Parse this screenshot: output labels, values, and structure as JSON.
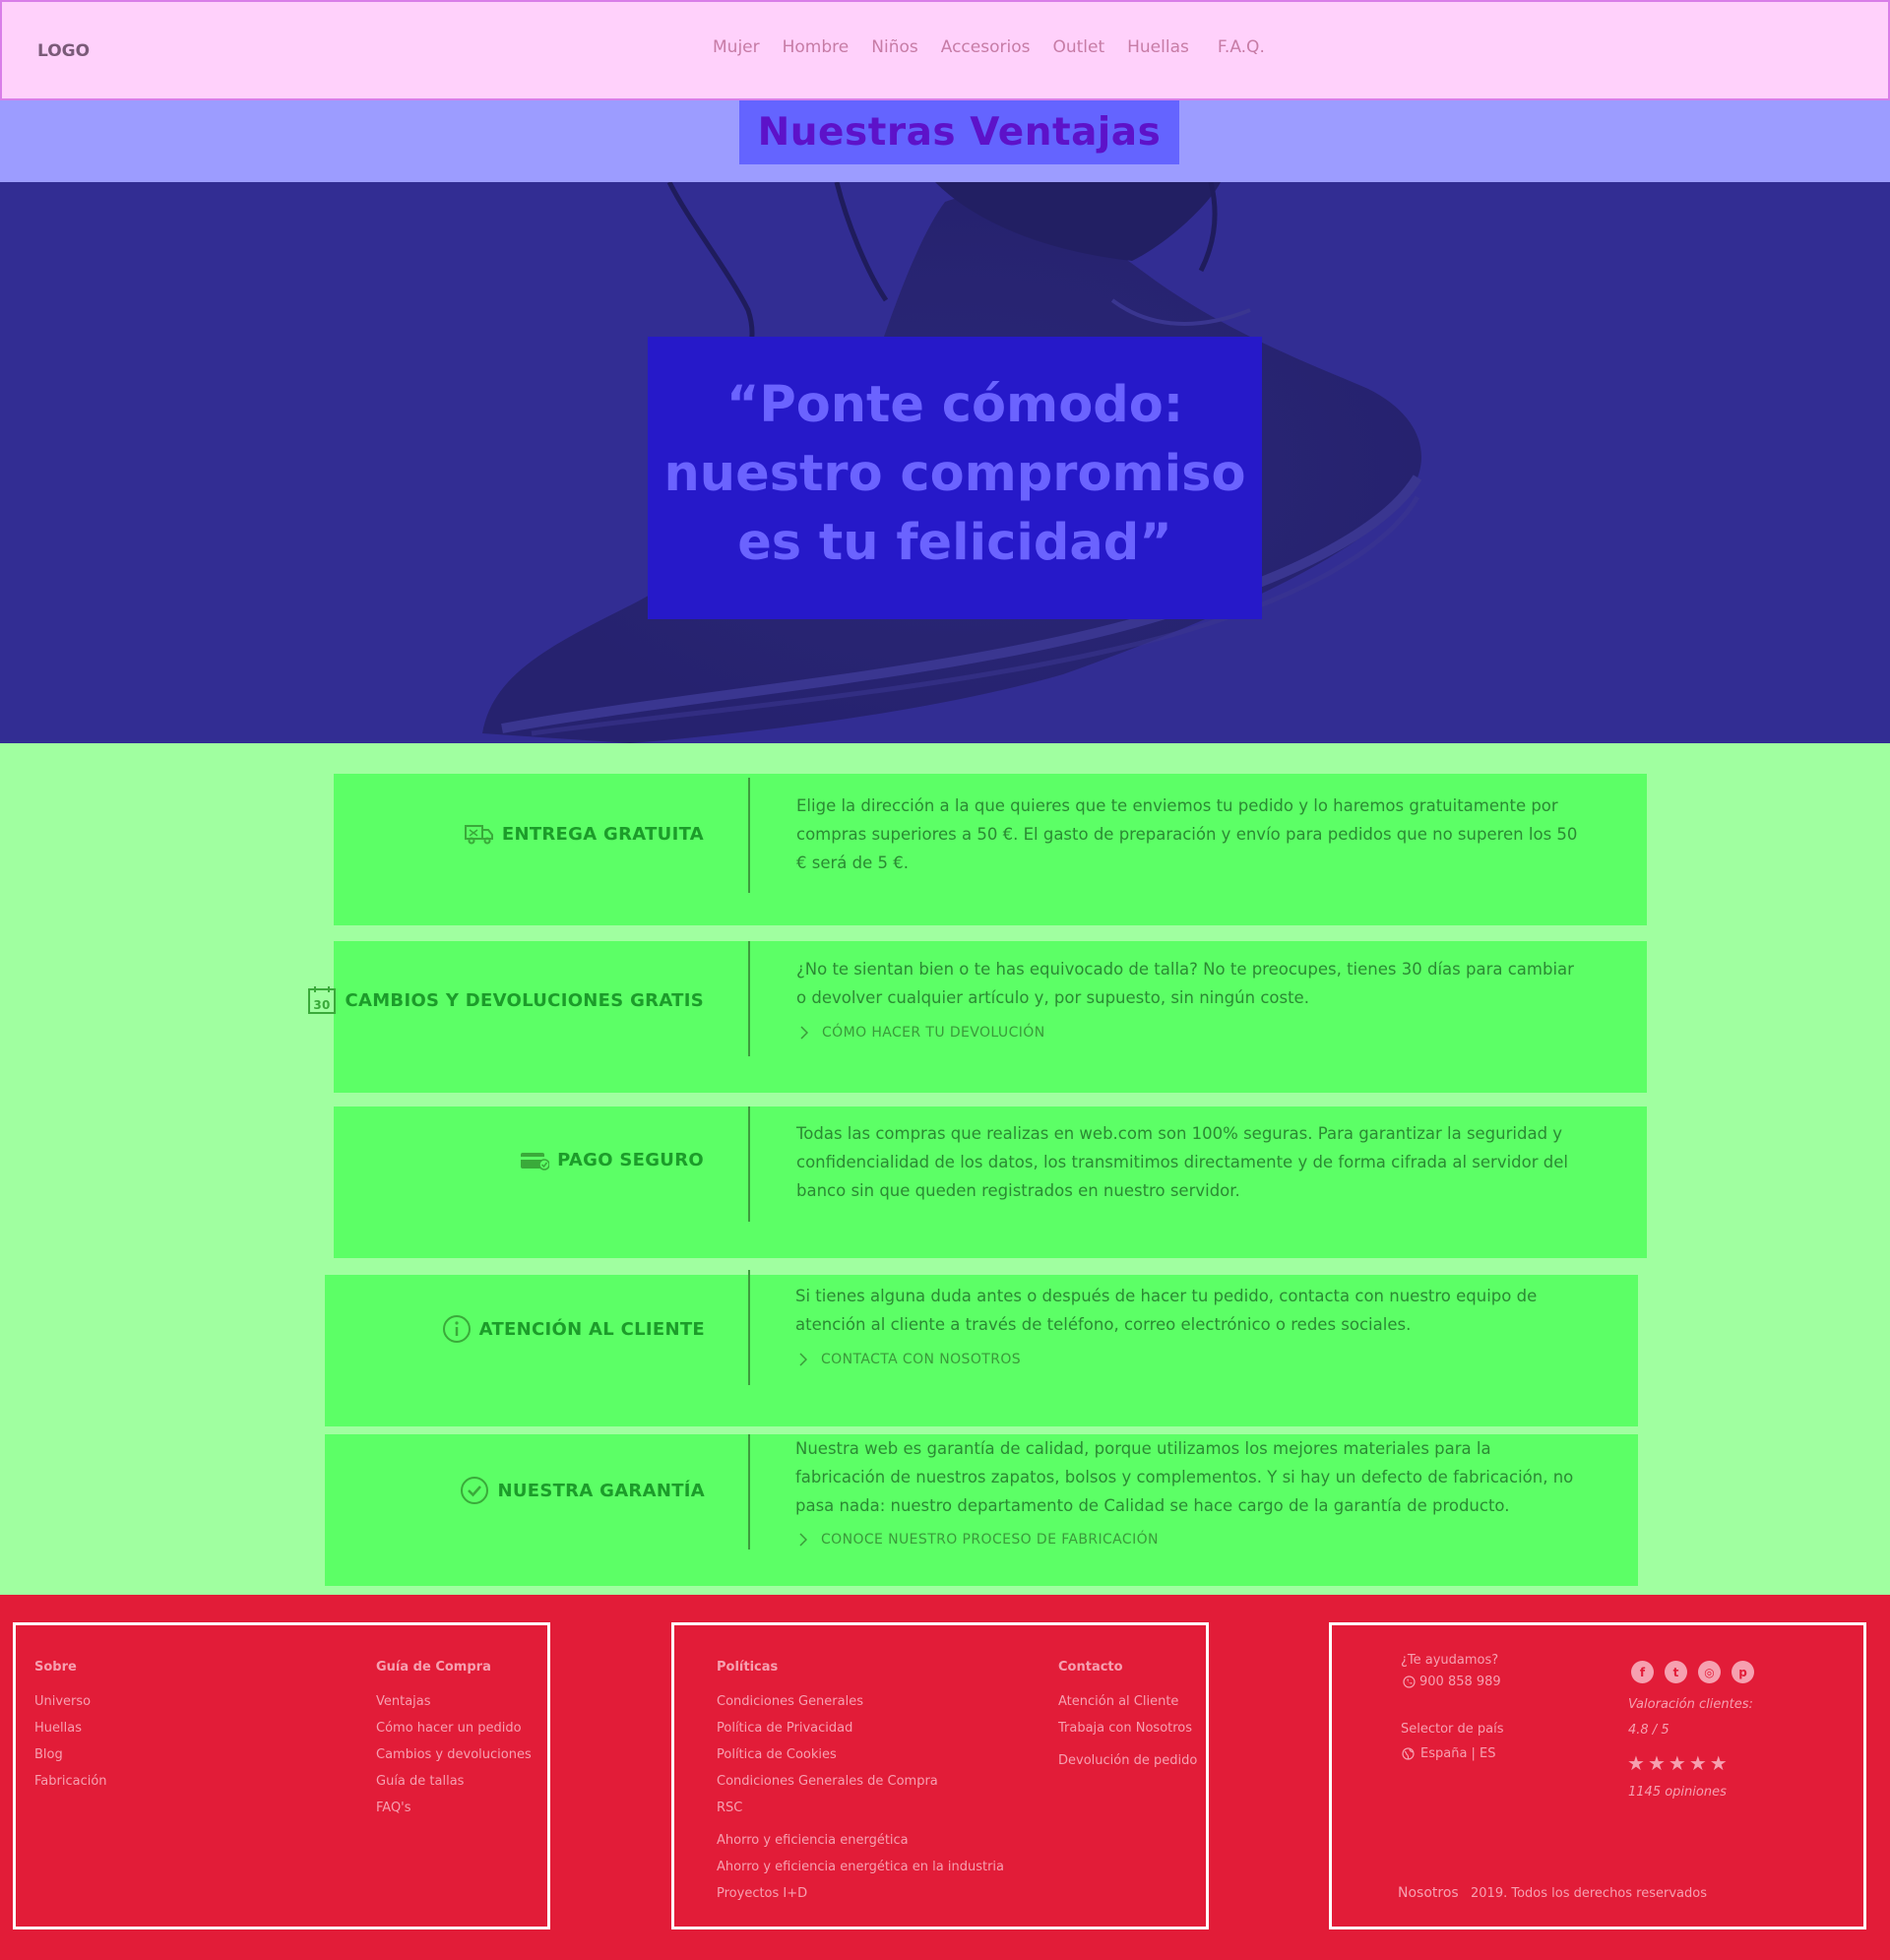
{
  "header": {
    "logo": "LOGO",
    "nav": [
      "Mujer",
      "Hombre",
      "Niños",
      "Accesorios",
      "Outlet",
      "Huellas",
      "F.A.Q."
    ]
  },
  "section_title": "Nuestras Ventajas",
  "hero": {
    "quote": "“Ponte cómodo: nuestro compromiso es tu felicidad”"
  },
  "features": [
    {
      "icon": "delivery-truck-icon",
      "title": "ENTREGA GRATUITA",
      "text": "Elige la dirección a la que quieres que te enviemos tu pedido y lo haremos gratuitamente por compras superiores a 50 €. El gasto de preparación y envío para pedidos que no superen los 50 € será de 5 €.",
      "link": ""
    },
    {
      "icon": "calendar-30-icon",
      "title": "CAMBIOS Y DEVOLUCIONES GRATIS",
      "text": "¿No te sientan bien o te has equivocado de talla? No te preocupes, tienes 30 días para cambiar o devolver cualquier artículo y, por supuesto, sin ningún coste.",
      "link": "CÓMO HACER TU DEVOLUCIÓN"
    },
    {
      "icon": "credit-card-icon",
      "title": "PAGO SEGURO",
      "text": "Todas las compras que realizas en web.com son 100% seguras. Para garantizar la seguridad y confidencialidad de los datos, los transmitimos directamente y de forma cifrada al servidor del banco sin que queden registrados en nuestro servidor.",
      "link": ""
    },
    {
      "icon": "info-circle-icon",
      "title": "ATENCIÓN AL CLIENTE",
      "text": "Si tienes alguna duda antes o después de hacer tu pedido, contacta con nuestro equipo de atención al cliente a través de teléfono, correo electrónico o redes sociales.",
      "link": "CONTACTA CON NOSOTROS"
    },
    {
      "icon": "check-circle-icon",
      "title": "NUESTRA GARANTÍA",
      "text": "Nuestra web es garantía de calidad, porque utilizamos los mejores materiales para la fabricación de nuestros zapatos, bolsos y complementos. Y si hay un defecto de fabricación, no pasa nada: nuestro departamento de Calidad se hace cargo de la garantía de producto.",
      "link": "CONOCE NUESTRO PROCESO DE FABRICACIÓN"
    }
  ],
  "footer": {
    "sobre": {
      "title": "Sobre",
      "items": [
        "Universo",
        "Huellas",
        "Blog",
        "Fabricación"
      ]
    },
    "guia": {
      "title": "Guía de Compra",
      "items": [
        "Ventajas",
        "Cómo hacer un pedido",
        "Cambios y devoluciones",
        "Guía de tallas",
        "FAQ's"
      ]
    },
    "politicas": {
      "title": "Políticas",
      "items": [
        "Condiciones Generales",
        "Política de Privacidad",
        "Política de Cookies",
        "Condiciones Generales de Compra",
        "RSC",
        "Ahorro y eficiencia energética",
        "Ahorro y eficiencia energética en la industria",
        "Proyectos I+D"
      ]
    },
    "contacto": {
      "title": "Contacto",
      "items": [
        "Atención al Cliente",
        "Trabaja con Nosotros",
        "Devolución de pedido"
      ]
    },
    "help": "¿Te ayudamos?",
    "phone": "900 858 989",
    "country_label": "Selector de país",
    "country_value": "España | ES",
    "social_icons": [
      "facebook-icon",
      "twitter-icon",
      "instagram-icon",
      "pinterest-icon"
    ],
    "rating_label": "Valoración clientes:",
    "rating_value": "4.8 / 5",
    "rating_stars": 5,
    "reviews": "1145 opiniones",
    "brand": "Nosotros",
    "copyright": "2019. Todos los derechos reservados"
  }
}
